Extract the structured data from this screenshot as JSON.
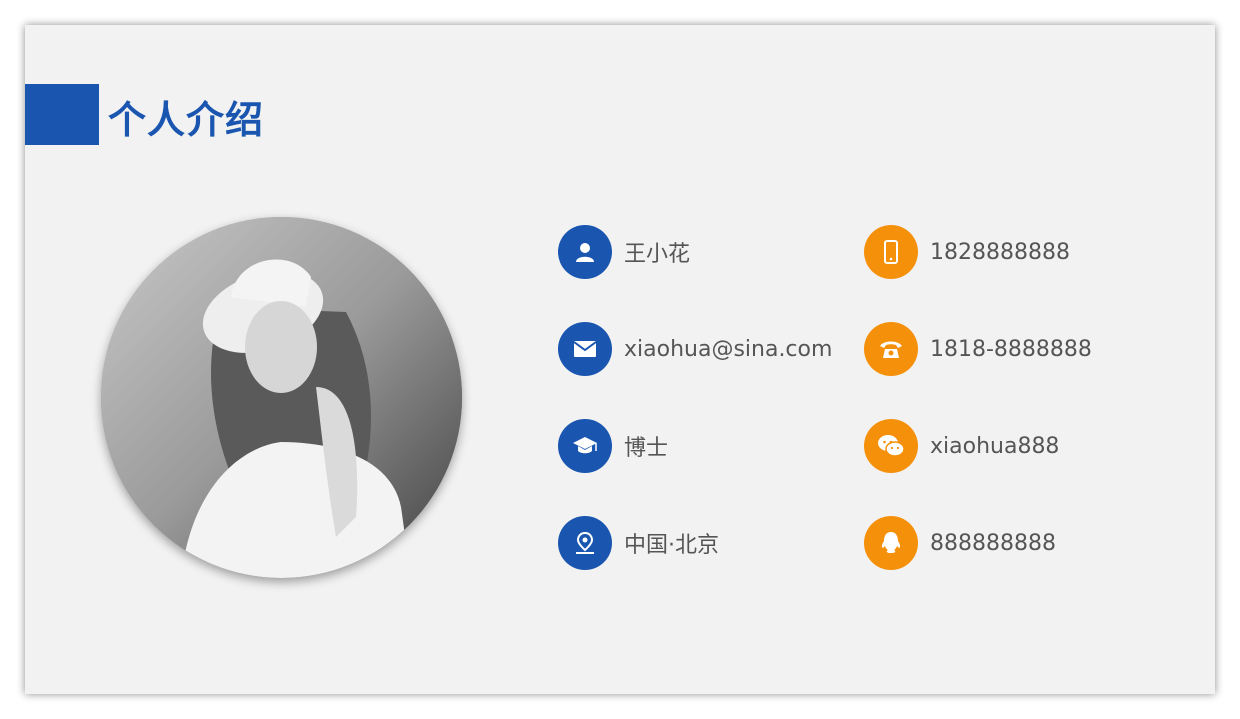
{
  "title": "个人介绍",
  "colors": {
    "accent_blue": "#1a56b0",
    "accent_orange": "#f5900b",
    "background": "#f2f2f2",
    "text": "#555555"
  },
  "photo": {
    "icon": "profile-photo"
  },
  "left_items": [
    {
      "icon": "user-icon",
      "text": "王小花"
    },
    {
      "icon": "mail-icon",
      "text": "xiaohua@sina.com"
    },
    {
      "icon": "graduation-cap-icon",
      "text": "博士"
    },
    {
      "icon": "location-pin-icon",
      "text": "中国·北京"
    }
  ],
  "right_items": [
    {
      "icon": "mobile-phone-icon",
      "text": "1828888888"
    },
    {
      "icon": "telephone-icon",
      "text": "1818-8888888"
    },
    {
      "icon": "wechat-icon",
      "text": "xiaohua888"
    },
    {
      "icon": "qq-icon",
      "text": "888888888"
    }
  ]
}
